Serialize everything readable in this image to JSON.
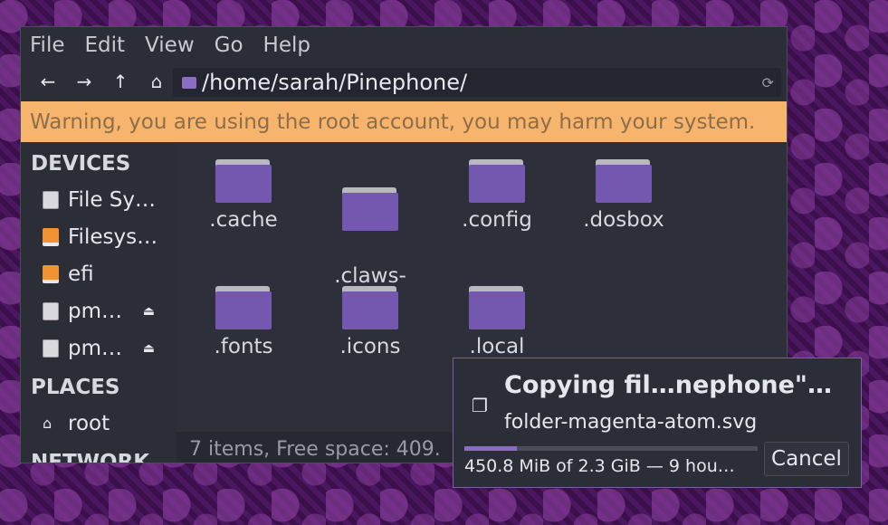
{
  "menu": [
    "File",
    "Edit",
    "View",
    "Go",
    "Help"
  ],
  "toolbar": {
    "back": "←",
    "forward": "→",
    "up": "↑",
    "home": "⌂",
    "reload": "⟳"
  },
  "location": {
    "path": "/home/sarah/Pinephone/"
  },
  "warning": "Warning, you are using the root account, you may harm your system.",
  "sidebar": {
    "devices_heading": "DEVICES",
    "devices": [
      {
        "label": "File Sy…",
        "icon": "disk-icon",
        "eject": false
      },
      {
        "label": "Filesys…",
        "icon": "drive-orange-icon",
        "eject": false
      },
      {
        "label": "efi",
        "icon": "drive-orange-icon",
        "eject": false
      },
      {
        "label": "pm…",
        "icon": "disk-icon",
        "eject": true
      },
      {
        "label": "pm…",
        "icon": "disk-icon",
        "eject": true
      }
    ],
    "places_heading": "PLACES",
    "places": [
      {
        "label": "root",
        "icon": "home-icon"
      }
    ],
    "network_heading": "NETWORK"
  },
  "files": [
    ".cache",
    ".claws-\nmail",
    ".config",
    ".dosbox",
    ".fonts",
    ".icons",
    ".local"
  ],
  "status": "7 items, Free space: 409.",
  "dialog": {
    "title": "Copying fil…nephone\"…",
    "current_file": "folder-magenta-atom.svg",
    "progress": 0.18,
    "detail": "450.8 MiB of 2.3 GiB — 9 hou…",
    "cancel_label": "Cancel"
  },
  "colors": {
    "accent": "#8b6dc2",
    "warning_bg": "#f7b46c",
    "folder": "#7458b0"
  }
}
